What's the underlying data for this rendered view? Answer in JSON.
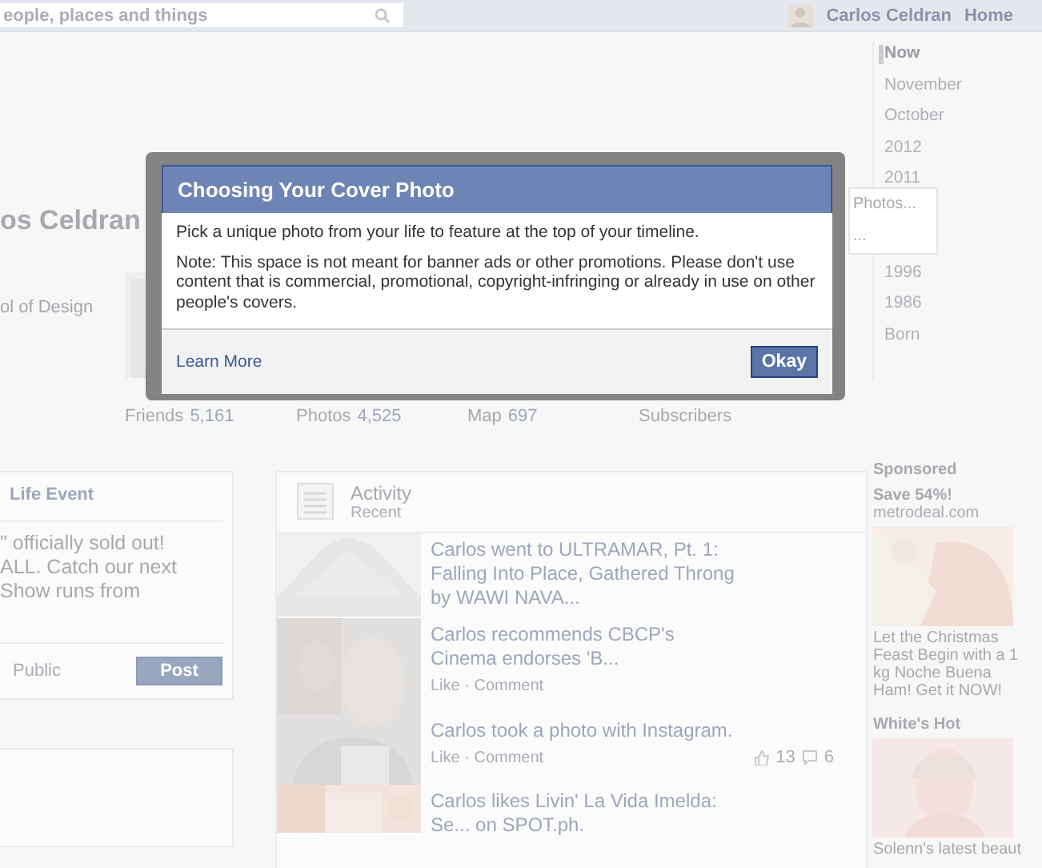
{
  "top_bar": {
    "search": {
      "placeholder": "eople, places and things"
    },
    "user_name": "Carlos Celdran",
    "home": "Home"
  },
  "profile": {
    "name": "os Celdran",
    "education": "ol of Design",
    "nav": [
      {
        "label": "Friends",
        "count": "5,161"
      },
      {
        "label": "Photos",
        "count": "4,525"
      },
      {
        "label": "Map",
        "count": "697"
      },
      {
        "label": "Subscribers"
      }
    ]
  },
  "timeline": [
    {
      "label": "Now",
      "selected": true
    },
    {
      "label": "November",
      "selected": false
    },
    {
      "label": "October",
      "selected": false
    },
    {
      "label": "2012",
      "selected": false
    },
    {
      "label": "2011",
      "selected": false
    },
    {
      "label": "1996",
      "selected": false
    },
    {
      "label": "1986",
      "selected": false
    },
    {
      "label": "Born",
      "selected": false
    }
  ],
  "popup": {
    "items": [
      "Photos...",
      "..."
    ]
  },
  "composer": {
    "tab": "Life Event",
    "text": "\" officially sold out!\nALL. Catch our next\nShow runs from",
    "privacy": "Public",
    "post": "Post"
  },
  "activity": {
    "title": "Activity",
    "subtitle": "Recent",
    "stories": [
      {
        "text": "Carlos went to ULTRAMAR, Pt. 1: Falling Into Place, Gathered Throng by WAWI NAVA..."
      },
      {
        "text": "Carlos recommends CBCP's Cinema endorses 'B...",
        "actions": "Like · Comment"
      },
      {
        "text": "Carlos took a photo with Instagram.",
        "actions": "Like · Comment",
        "likes": "13",
        "comments": "6"
      },
      {
        "text": "Carlos likes Livin' La Vida Imelda: Se... on SPOT.ph."
      }
    ]
  },
  "sponsored": {
    "title": "Sponsored",
    "ads": [
      {
        "title": "Save 54%!",
        "site": "metrodeal.com",
        "text": "Let the Christmas Feast Begin with a 1 kg Noche Buena Ham! Get it NOW!"
      },
      {
        "title": "White's Hot",
        "text": "Solenn's latest beaut"
      }
    ]
  },
  "dialog": {
    "title": "Choosing Your Cover Photo",
    "paragraphs": [
      "Pick a unique photo from your life to feature at the top of your timeline.",
      "Note: This space is not meant for banner ads or other promotions. Please don't use content that is commercial, promotional, copyright-infringing or already in use on other people's covers."
    ],
    "link": "Learn More",
    "button": "Okay"
  }
}
